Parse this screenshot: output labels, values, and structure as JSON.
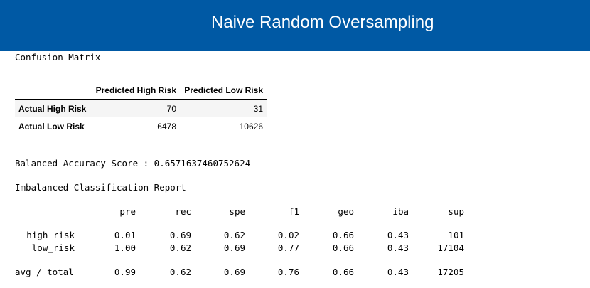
{
  "banner": {
    "title": "Naive Random Oversampling",
    "background_color": "#0059a4"
  },
  "confusion_matrix": {
    "label": "Confusion Matrix",
    "columns": [
      "Predicted High Risk",
      "Predicted Low Risk"
    ],
    "rows": [
      {
        "label": "Actual High Risk",
        "values": [
          "70",
          "31"
        ]
      },
      {
        "label": "Actual Low Risk",
        "values": [
          "6478",
          "10626"
        ]
      }
    ]
  },
  "balanced_accuracy": {
    "text": "Balanced Accuracy Score : 0.6571637460752624"
  },
  "report": {
    "label": "Imbalanced Classification Report",
    "headers": [
      "pre",
      "rec",
      "spe",
      "f1",
      "geo",
      "iba",
      "sup"
    ],
    "rows": [
      {
        "label": "high_risk",
        "values": [
          "0.01",
          "0.69",
          "0.62",
          "0.02",
          "0.66",
          "0.43",
          "101"
        ]
      },
      {
        "label": "low_risk",
        "values": [
          "1.00",
          "0.62",
          "0.69",
          "0.77",
          "0.66",
          "0.43",
          "17104"
        ]
      },
      {
        "label": "avg / total",
        "values": [
          "0.99",
          "0.62",
          "0.69",
          "0.76",
          "0.66",
          "0.43",
          "17205"
        ]
      }
    ]
  }
}
